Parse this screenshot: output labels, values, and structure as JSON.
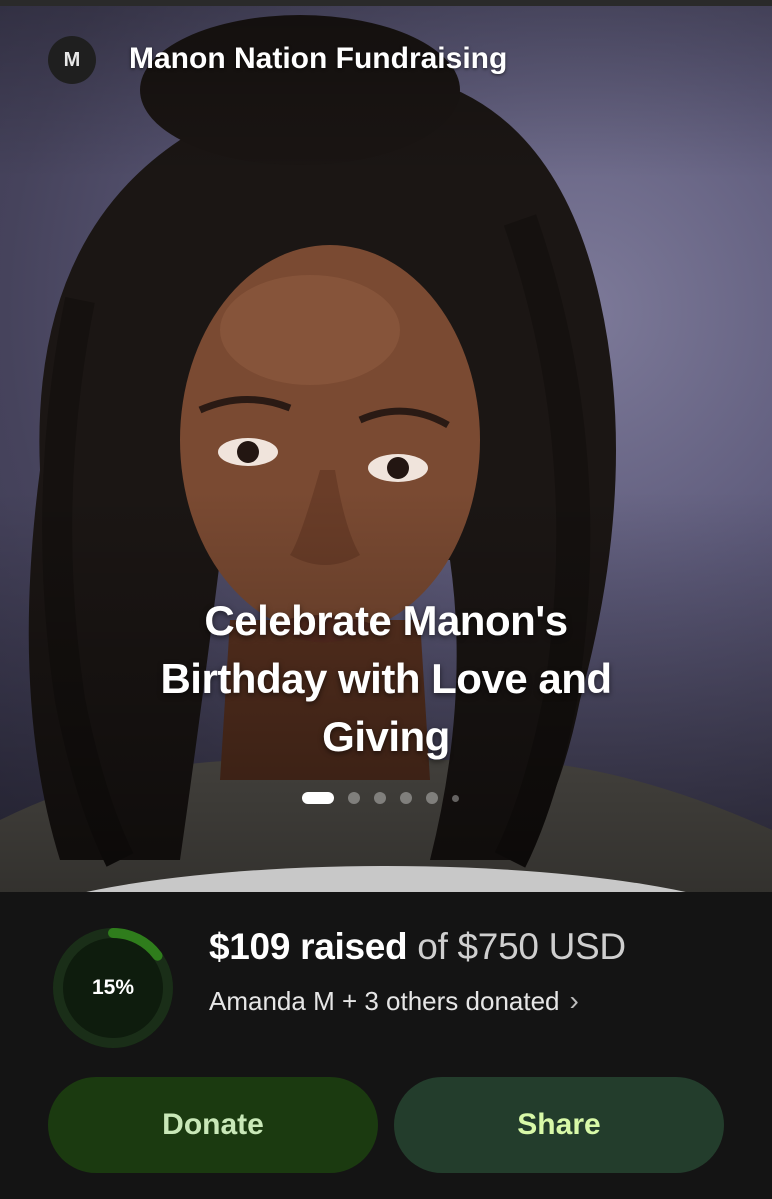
{
  "header": {
    "avatar_letter": "M",
    "org_name": "Manon Nation Fundraising"
  },
  "hero": {
    "title": "Celebrate Manon's Birthday with Love and Giving",
    "image_description_icon": "portrait-photo",
    "carousel": {
      "total_dots": 6,
      "active_index": 0
    }
  },
  "progress": {
    "percent_label": "15%",
    "percent_value": 15,
    "raised_amount": "$109 raised",
    "goal_text": "of $750 USD",
    "donors_text": "Amanda M + 3 others donated",
    "donors_chevron_icon": "chevron-right-icon"
  },
  "actions": {
    "donate_label": "Donate",
    "share_label": "Share"
  },
  "colors": {
    "accent_ring": "#2f7d1c",
    "donate_bg": "#1b3a10",
    "share_bg": "#233d2c"
  }
}
